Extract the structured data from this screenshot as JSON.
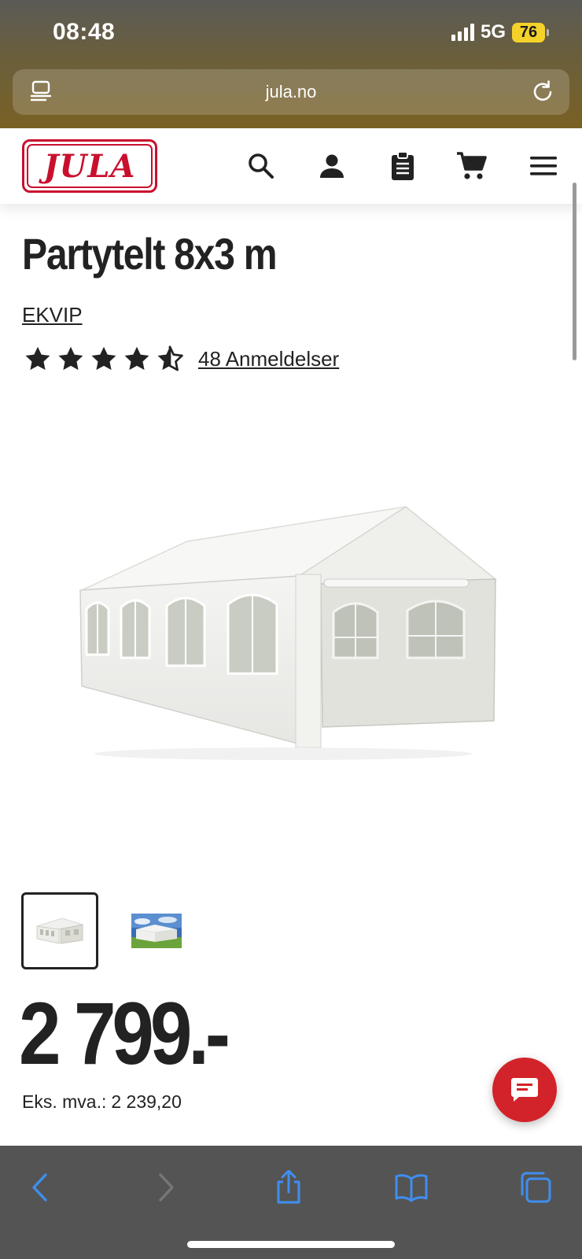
{
  "status_bar": {
    "time": "08:48",
    "network": "5G",
    "battery": "76"
  },
  "browser": {
    "url": "jula.no"
  },
  "site_header": {
    "logo_text": "JULA",
    "icons": [
      "search-icon",
      "account-icon",
      "shopping-list-icon",
      "cart-icon",
      "menu-icon"
    ]
  },
  "product": {
    "title": "Partytelt 8x3 m",
    "brand": "EKVIP",
    "rating": 4.5,
    "rating_max": 5,
    "reviews_label": "48 Anmeldelser",
    "price": "2 799.-",
    "ex_vat_label": "Eks. mva.:",
    "ex_vat_value": "2 239,20",
    "thumbnails": 2,
    "selected_thumbnail": 1
  },
  "colors": {
    "brand_red": "#c8102e",
    "chat_red": "#d2232a",
    "ios_blue": "#3f8ef0",
    "battery_yellow": "#f5d22a"
  },
  "toolbar": {
    "icons": [
      "back-icon",
      "forward-icon",
      "share-icon",
      "bookmarks-icon",
      "tabs-icon"
    ]
  }
}
